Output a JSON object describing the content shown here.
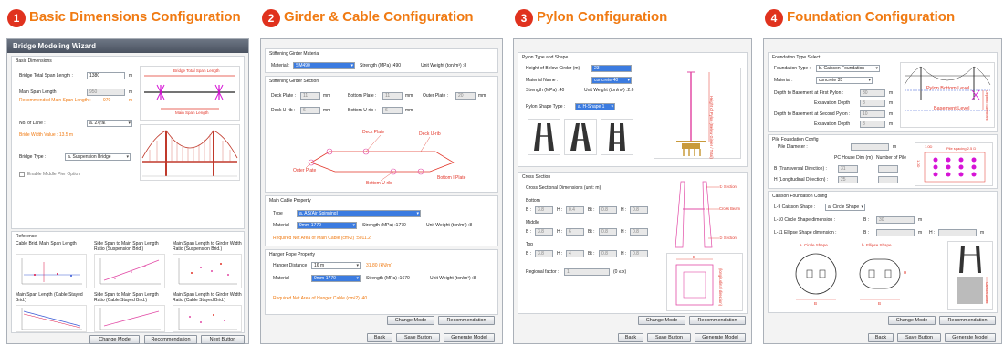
{
  "steps": [
    {
      "num": "1",
      "title": "Basic Dimensions Configuration"
    },
    {
      "num": "2",
      "title": "Girder & Cable Configuration"
    },
    {
      "num": "3",
      "title": "Pylon Configuration"
    },
    {
      "num": "4",
      "title": "Foundation Configuration"
    }
  ],
  "colors": {
    "step_badge": "#e0321e",
    "step_title": "#f07a12",
    "select_highlight": "#3b7be0",
    "diagram_red": "#e2362a",
    "diagram_magenta": "#d614d6"
  },
  "p1": {
    "window_title": "Bridge Modeling Wizard",
    "basic_dims": "Basic Dimensions",
    "total_span_label": "Bridge Total Span Length :",
    "total_span_value": "1380",
    "unit_m": "m",
    "main_span_label": "Main Span Length :",
    "main_span_value": "950",
    "recommended": "Recommended Main Span Length :",
    "recommended_value": "970",
    "recommended_unit": "m",
    "lanes_label": "No. of Lane :",
    "lanes_value": "a. 2차로",
    "bridge_width": "Bride Width Value : 13.5 m",
    "bridge_type_label": "Bridge Type :",
    "bridge_type_value": "a. Suspension Bridge",
    "middle_pier": "Enable Middle Pier Option",
    "diag_total": "Bridge Total Span Length",
    "diag_main": "Main Span Length",
    "reference": "Reference",
    "ref_titles": [
      "Cable Brid. Main Span Length",
      "Side Span to Main Span Length Ratio (Suspension Brid.)",
      "Main Span Length to Girder Width Ratio (Suspension Brid.)",
      "Main Span Length (Cable Stayed Brid.)",
      "Side Span to Main Span Length Ratio (Cable Stayed Brid.)",
      "Main Span Length to Girder Width Ratio (Cable Stayed Brid.)"
    ],
    "btn_change_mode": "Change Mode",
    "btn_recommendation": "Recommendation",
    "btn_next": "Next Button"
  },
  "p2": {
    "girder_material": "Stiffening Girder Material",
    "material_label": "Material :",
    "material_value": "SM490",
    "strength": "Strength (MPa) :490",
    "unit_weight": "Unit Weight (ton/m³) :8",
    "girder_section": "Stiffening Girder Section",
    "deck_plate": "Deck Plate :",
    "deck_plate_v": "11",
    "mm": "mm",
    "bottom_plate": "Bottom Plate :",
    "bottom_plate_v": "11",
    "outer_plate": "Outer Plate :",
    "outer_plate_v": "20",
    "deck_urib": "Deck U-rib :",
    "deck_urib_v": "6",
    "bottom_urib": "Bottom U-rib :",
    "bottom_urib_v": "6",
    "diag": [
      "Deck Plate",
      "Deck U-rib",
      "Outer Plate",
      "Bottom U-rib",
      "Bottom I Plate"
    ],
    "main_cable": "Main Cable Property",
    "type_label": "Type",
    "type_value": "a. AS(Air Spinning)",
    "cable_material_label": "Material",
    "cable_material_value": "9mm-1770",
    "cable_strength": "Strength (MPa) :1770",
    "cable_weight": "Unit Weight (ton/m³) :8",
    "cable_required": "Required Net Area of Main Cable (cm²2) :5011.2",
    "hanger": "Hanger Rope Property",
    "hanger_dist_label": "Hanger Distance",
    "hanger_dist_value": "16 m",
    "hanger_load": "31.80 (kN/m)",
    "hanger_material_label": "Material",
    "hanger_material_value": "9mm-1770",
    "hanger_strength": "Strength (MPa) :1670",
    "hanger_weight": "Unit Weight (ton/m³) :8",
    "hanger_required": "Required Net Area of Hanger Cable (cm²2) :40",
    "btn_change_mode": "Change Mode",
    "btn_recommendation": "Recommendation",
    "btn_back": "Back",
    "btn_save": "Save Button",
    "btn_generate": "Generate Model"
  },
  "p3": {
    "pylon_type": "Pylon Type and Shape",
    "height_label": "Height of Below Girder (m)",
    "height_value": "23",
    "material_label": "Material Name :",
    "material_value": "concrete 40",
    "strength": "Strength (MPa) :40",
    "unit_weight": "Unit Weight (ton/m³) :2.6",
    "shape_label": "Pylon Shape Type :",
    "shape_value": "a. H-Shape 1",
    "diag_vertical": "Height of Pylon (Below Girder / Total)",
    "cross_section": "Cross Section",
    "cs_dims": "Cross Sectional Dimensions (unit: m)",
    "bottom": "Bottom",
    "middle": "Middle",
    "top": "Top",
    "rows": [
      {
        "B": "3.8",
        "Bt": "0.4",
        "Bt2": "0.8",
        "H": "0.8"
      },
      {
        "B": "3.8",
        "Bt": "6",
        "Bt2": "0.8",
        "H": "0.8"
      },
      {
        "B": "3.8",
        "Bt": "4",
        "Bt2": "0.8",
        "H": "0.8"
      }
    ],
    "lbl_B": "B :",
    "lbl_Bt": "Bt :",
    "lbl_H": "H :",
    "regional": "Regional factor :",
    "regional_value": "1",
    "regional_range": "(0 ≤ x)",
    "diag_section1": "① Section",
    "diag_crossbeam": "Cross Beam",
    "diag_section2": "② Section",
    "diag_longitudinal": "(longitudinal direction)",
    "diag_B": "B",
    "btn_change_mode": "Change Mode",
    "btn_recommendation": "Recommendation",
    "btn_back": "Back",
    "btn_save": "Save Button",
    "btn_generate": "Generate Model"
  },
  "p4": {
    "type_select": "Foundation Type Select",
    "found_type_label": "Foundation Type :",
    "found_type_value": "b. Caisson Foundation",
    "material_label": "Material :",
    "material_value": "concrete 35",
    "depth1_label": "Depth to Basement at First Pylon :",
    "depth1_value": "30",
    "exc1_label": "Excavation Depth :",
    "exc1_value": "8",
    "depth2_label": "Depth to Basement at Second Pylon :",
    "depth2_value": "10",
    "exc2_label": "Excavation Depth :",
    "exc2_value": "8",
    "unit_m": "m",
    "diag_pylon_bottom": "Pylon Bottom Level",
    "diag_basement": "Basement Level",
    "diag_depth": "Depth to Basement",
    "pile_config": "Pile Foundation Config",
    "pile_diameter": "Pile Diameter :",
    "pc_house": "PC House Dim (m)",
    "num_pile": "Number of Pile",
    "b_trans": "B (Transversal Direction) :",
    "b_trans_v": "31",
    "h_long": "H (Longitudinal Direction) :",
    "h_long_v": "25",
    "pile_diag_top": "1.0D",
    "pile_diag_spacing": "Pile spacing 2.5 D",
    "pile_diag_side": "1.0D",
    "caisson_config": "Caisson Foundation Config",
    "l9": "L-9 Caisson Shape :",
    "l9_value": "a. Circle Shape",
    "l10": "L-10 Circle Shape dimension :",
    "l10_B": "B :",
    "l10_B_v": "30",
    "l11": "L-11 Ellipse Shape dimension :",
    "l11_B": "B :",
    "l11_H": "H :",
    "diag_circle": "a. Circle Shape",
    "diag_ellipse": "b. Ellipse Shape",
    "diag_B": "B",
    "diag_H": "H",
    "diag_caisson_depth": "Caisson Depth",
    "btn_change_mode": "Change Mode",
    "btn_recommendation": "Recommendation",
    "btn_back": "Back",
    "btn_save": "Save Button",
    "btn_generate": "Generate Model"
  }
}
